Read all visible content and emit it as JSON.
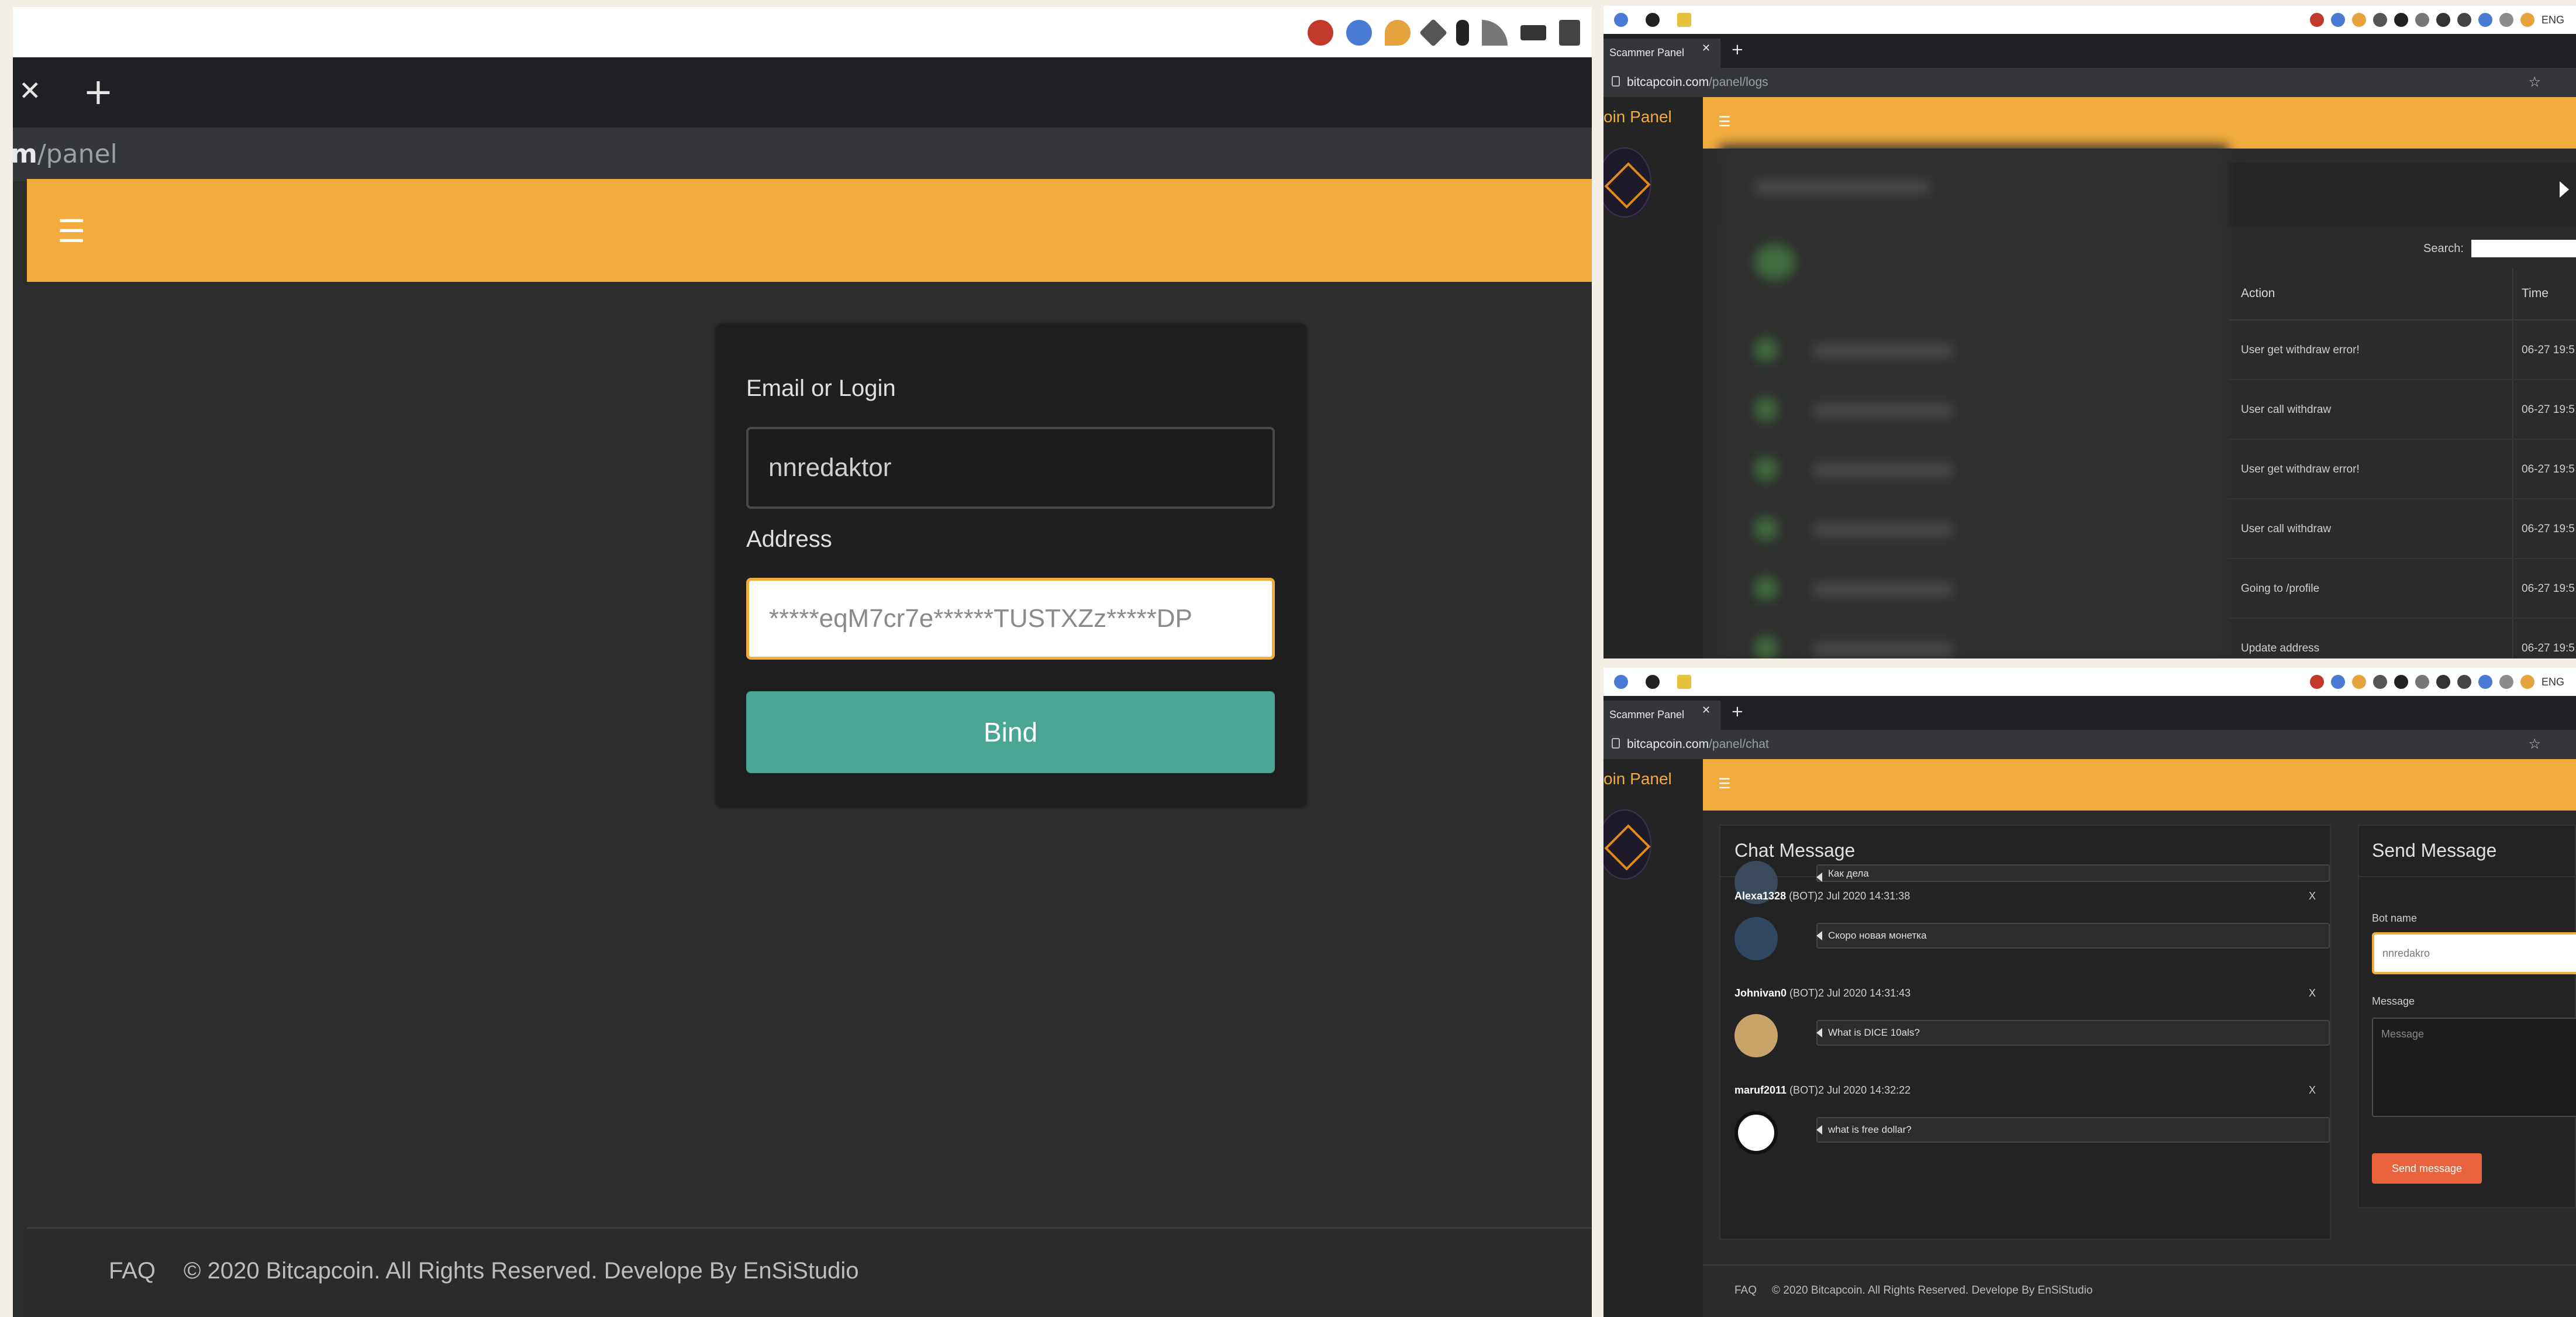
{
  "left": {
    "url_host_tail": "m",
    "url_path": "/panel",
    "menu_icon": "hamburger-icon",
    "form": {
      "login_label": "Email or Login",
      "login_value": "nnredaktor",
      "address_label": "Address",
      "address_value": "*****eqM7cr7e******TUSTXZz*****DP",
      "bind_label": "Bind"
    },
    "footer": {
      "faq": "FAQ",
      "copyright": "© 2020 Bitcapcoin. All Rights Reserved. Develope By EnSiStudio"
    }
  },
  "logs_window": {
    "tab_title": "Scammer Panel",
    "url_host": "bitcapcoin.com",
    "url_path": "/panel/logs",
    "brand": "oin Panel",
    "search_label": "Search:",
    "columns": [
      "Action",
      "Time"
    ],
    "rows": [
      {
        "action": "User get withdraw error!",
        "time": "06-27 19:5"
      },
      {
        "action": "User call withdraw",
        "time": "06-27 19:5"
      },
      {
        "action": "User get withdraw error!",
        "time": "06-27 19:5"
      },
      {
        "action": "User call withdraw",
        "time": "06-27 19:5"
      },
      {
        "action": "Going to /profile",
        "time": "06-27 19:5"
      },
      {
        "action": "Update address",
        "time": "06-27 19:5"
      }
    ]
  },
  "chat_window": {
    "tab_title": "Scammer Panel",
    "url_host": "bitcapcoin.com",
    "url_path": "/panel/chat",
    "brand": "oin Panel",
    "chat_title": "Chat Message",
    "messages": [
      {
        "user": "",
        "meta": "",
        "text": "Как дела",
        "close": ""
      },
      {
        "user": "Alexa1328",
        "meta": " (BOT)2 Jul 2020 14:31:38",
        "text": "Скоро новая монетка",
        "close": "X"
      },
      {
        "user": "Johnivan0",
        "meta": " (BOT)2 Jul 2020 14:31:43",
        "text": "What is DICE 10als?",
        "close": "X"
      },
      {
        "user": "maruf2011",
        "meta": " (BOT)2 Jul 2020 14:32:22",
        "text": "what is free dollar?",
        "close": "X"
      }
    ],
    "send": {
      "title": "Send Message",
      "bot_name_label": "Bot name",
      "bot_name_value": "nnredakro",
      "message_label": "Message",
      "message_placeholder": "Message",
      "send_button": "Send message"
    },
    "footer": {
      "faq": "FAQ",
      "copyright": "© 2020 Bitcapcoin. All Rights Reserved. Develope By EnSiStudio"
    }
  },
  "system_tray": {
    "lang": "ENG"
  },
  "colors": {
    "accent": "#f2ac3e",
    "bind_button": "#4aa692",
    "send_button": "#e8623b"
  }
}
